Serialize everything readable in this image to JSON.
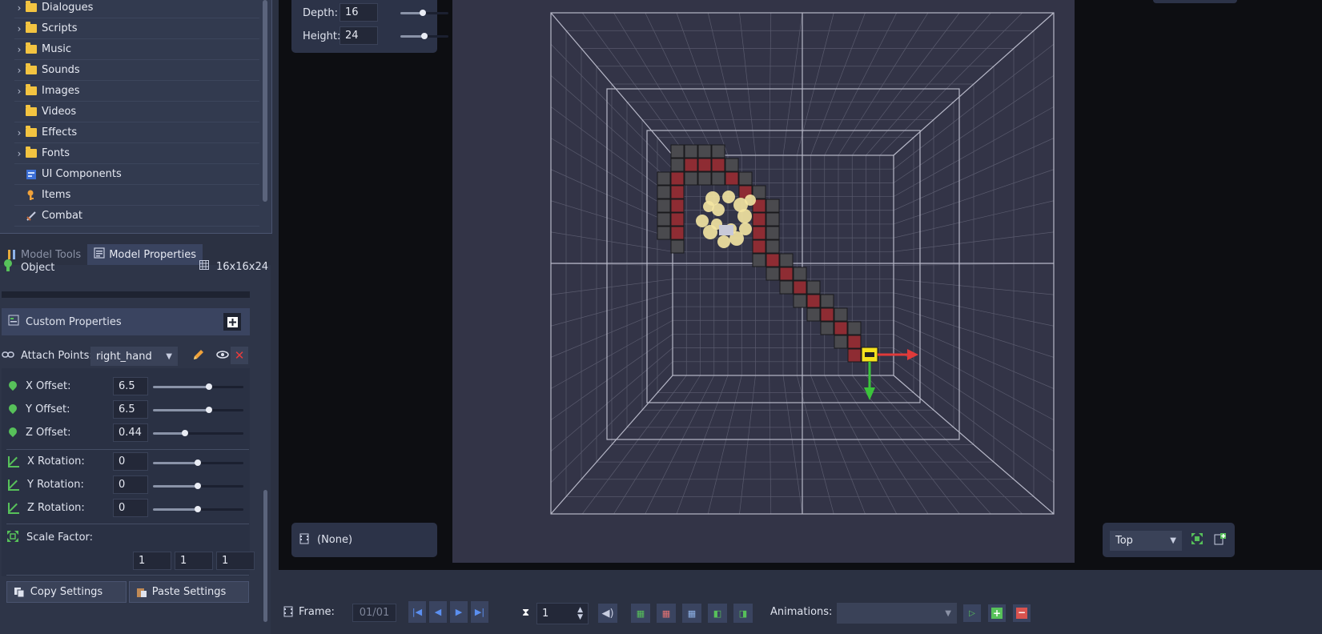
{
  "tree": {
    "items": [
      {
        "label": "Dialogues",
        "icon": "folder-icon",
        "expandable": true
      },
      {
        "label": "Scripts",
        "icon": "folder-icon",
        "expandable": true
      },
      {
        "label": "Music",
        "icon": "folder-icon",
        "expandable": true
      },
      {
        "label": "Sounds",
        "icon": "folder-icon",
        "expandable": true
      },
      {
        "label": "Images",
        "icon": "folder-icon",
        "expandable": true
      },
      {
        "label": "Videos",
        "icon": "folder-icon",
        "expandable": false
      },
      {
        "label": "Effects",
        "icon": "folder-icon",
        "expandable": true
      },
      {
        "label": "Fonts",
        "icon": "folder-icon",
        "expandable": true
      },
      {
        "label": "UI Components",
        "icon": "ui-components-icon",
        "expandable": false
      },
      {
        "label": "Items",
        "icon": "key-icon",
        "expandable": false
      },
      {
        "label": "Combat",
        "icon": "sword-icon",
        "expandable": false
      }
    ]
  },
  "tabs": {
    "model_tools": "Model Tools",
    "model_properties": "Model Properties"
  },
  "object": {
    "label": "Object",
    "size": "16x16x24"
  },
  "custom_properties": {
    "label": "Custom Properties"
  },
  "attach": {
    "label": "Attach Points:",
    "value": "right_hand"
  },
  "offsets": {
    "x": {
      "label": "X Offset:",
      "value": "6.5",
      "slider_level": 0.62
    },
    "y": {
      "label": "Y Offset:",
      "value": "6.5",
      "slider_level": 0.62
    },
    "z": {
      "label": "Z Offset:",
      "value": "0.44",
      "slider_level": 0.35
    }
  },
  "rotations": {
    "x": {
      "label": "X Rotation:",
      "value": "0",
      "slider_level": 0.5
    },
    "y": {
      "label": "Y Rotation:",
      "value": "0",
      "slider_level": 0.5
    },
    "z": {
      "label": "Z Rotation:",
      "value": "0",
      "slider_level": 0.5
    }
  },
  "scale": {
    "label": "Scale Factor:",
    "x": "1",
    "y": "1",
    "z": "1"
  },
  "buttons": {
    "copy": "Copy Settings",
    "paste": "Paste Settings"
  },
  "dims": {
    "depth": {
      "label": "Depth:",
      "value": "16",
      "slider_level": 0.45
    },
    "height": {
      "label": "Height:",
      "value": "24",
      "slider_level": 0.47
    }
  },
  "animation_slot": {
    "label": "(None)"
  },
  "view": {
    "value": "Top"
  },
  "timeline": {
    "frame_label": "Frame:",
    "frame_value": "01/01",
    "speed_value": "1",
    "animations_label": "Animations:",
    "animations_value": ""
  },
  "colors": {
    "accent": "#57c15a",
    "voxel_red": "#8e2c33",
    "voxel_gray": "#4a4a4e",
    "axis_x": "#e03a3a",
    "axis_y": "#3bc43b",
    "gizmo": "#f5e21d"
  }
}
